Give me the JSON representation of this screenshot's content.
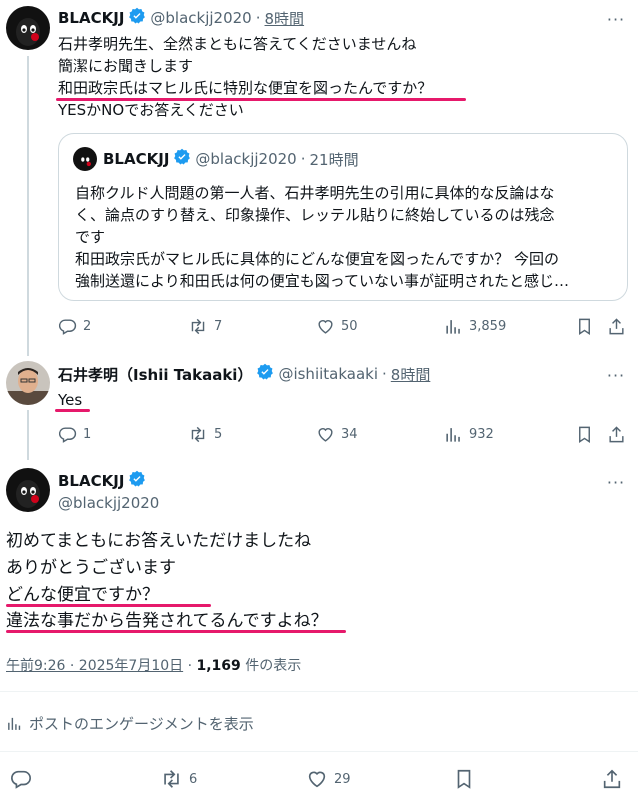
{
  "tweet1": {
    "name": "BLACKJJ",
    "handle": "@blackjj2020",
    "sep": "·",
    "time": "8時間",
    "lines": [
      "石井孝明先生、全然まともに答えてくださいませんね",
      "簡潔にお聞きします",
      "和田政宗氏はマヒル氏に特別な便宜を図ったんですか？",
      "YESかNOでお答えください"
    ],
    "quote": {
      "name": "BLACKJJ",
      "handle": "@blackjj2020",
      "sep": "·",
      "time": "21時間",
      "lines": [
        "自称クルド人問題の第一人者、石井孝明先生の引用に具体的な反論はな",
        "く、論点のすり替え、印象操作、レッテル貼りに終始しているのは残念",
        "です",
        "和田政宗氏がマヒル氏に具体的にどんな便宜を図ったんですか？ 今回の",
        "強制送還により和田氏は何の便宜も図っていない事が証明されたと感じ…"
      ]
    },
    "actions": {
      "replies": "2",
      "reposts": "7",
      "likes": "50",
      "views": "3,859"
    }
  },
  "tweet2": {
    "name": "石井孝明（Ishii Takaaki）",
    "handle": "@ishiitakaaki",
    "sep": "·",
    "time": "8時間",
    "text": "Yes",
    "actions": {
      "replies": "1",
      "reposts": "5",
      "likes": "34",
      "views": "932"
    }
  },
  "main": {
    "name": "BLACKJJ",
    "handle": "@blackjj2020",
    "lines": [
      "初めてまともにお答えいただけましたね",
      "ありがとうございます",
      "どんな便宜ですか？",
      "違法な事だから告発されてるんですよね？"
    ],
    "timestamp": "午前9:26 · 2025年7月10日",
    "meta_sep": "·",
    "views_count": "1,169",
    "views_label": "件の表示",
    "engagement_label": "ポストのエンゲージメントを表示",
    "actions": {
      "reposts": "6",
      "likes": "29"
    }
  },
  "colors": {
    "verified": "#1d9bf0",
    "highlight": "#e6196b",
    "muted": "#536471",
    "text": "#0f1419"
  }
}
